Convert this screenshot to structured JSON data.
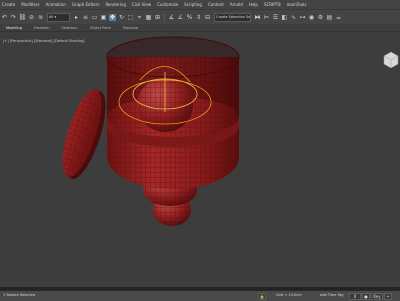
{
  "menubar": {
    "items": [
      "Create",
      "Modifiers",
      "Animation",
      "Graph Editors",
      "Rendering",
      "Civil View",
      "Customize",
      "Scripting",
      "Content",
      "Arnold",
      "Help",
      "SCRIPT8",
      "mainTools"
    ]
  },
  "toolbar": {
    "filter_value": "All",
    "selection_set_value": "Create Selection Se",
    "dropdown_glyph": "▾"
  },
  "ribbon": {
    "tabs": [
      "Modeling",
      "Freeform",
      "Selection",
      "Object Paint",
      "Populate"
    ]
  },
  "viewport": {
    "label": "[+] [Perspective] [Standard] [Default Shading]",
    "object_color": "#8a1c1c",
    "wire_color": "#5a0a0a",
    "gizmo_color": "#e8a21a",
    "background": "#3d3d3d"
  },
  "statusbar": {
    "object_info": "1 Sphere Selected",
    "grid_text": "Grid = 10.0cm",
    "add_time_tag": "Add Time Tag",
    "frame_field": "0",
    "key_button": "Key"
  }
}
